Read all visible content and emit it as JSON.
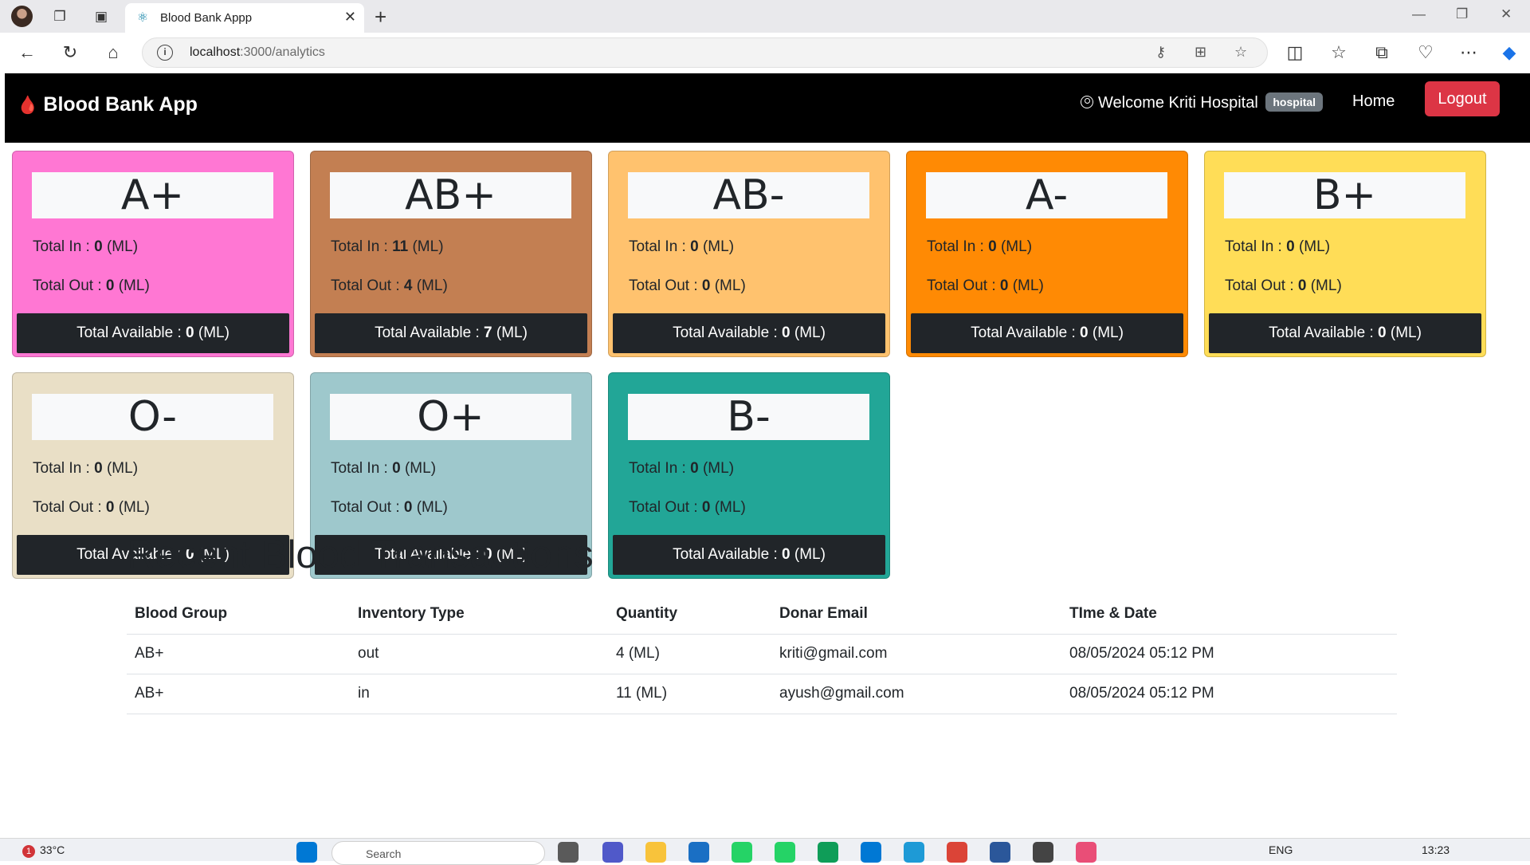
{
  "browser": {
    "tab_title": "Blood Bank Appp",
    "url_host": "localhost",
    "url_path": ":3000/analytics",
    "new_tab_glyph": "+",
    "close_glyph": "✕"
  },
  "navbar": {
    "brand": "Blood Bank App",
    "welcome": "Welcome Kriti Hospital",
    "role_badge": "hospital",
    "home_link": "Home",
    "logout_label": "Logout"
  },
  "labels": {
    "total_in": "Total In : ",
    "total_out": "Total Out : ",
    "total_available": "Total Available : ",
    "unit": " (ML)"
  },
  "cards": [
    {
      "group": "A+",
      "total_in": "0",
      "total_out": "0",
      "available": "0",
      "color": "#ff77d3"
    },
    {
      "group": "AB+",
      "total_in": "11",
      "total_out": "4",
      "available": "7",
      "color": "#c37f52"
    },
    {
      "group": "AB-",
      "total_in": "0",
      "total_out": "0",
      "available": "0",
      "color": "#ffc26e"
    },
    {
      "group": "A-",
      "total_in": "0",
      "total_out": "0",
      "available": "0",
      "color": "#ff8a04"
    },
    {
      "group": "B+",
      "total_in": "0",
      "total_out": "0",
      "available": "0",
      "color": "#ffdd57"
    },
    {
      "group": "O-",
      "total_in": "0",
      "total_out": "0",
      "available": "0",
      "color": "#e9dfc6"
    },
    {
      "group": "O+",
      "total_in": "0",
      "total_out": "0",
      "available": "0",
      "color": "#9ec8cc"
    },
    {
      "group": "B-",
      "total_in": "0",
      "total_out": "0",
      "available": "0",
      "color": "#22a697"
    }
  ],
  "transactions": {
    "title": "Recent Blood Transactions",
    "headers": [
      "Blood Group",
      "Inventory Type",
      "Quantity",
      "Donar Email",
      "TIme & Date"
    ],
    "rows": [
      [
        "AB+",
        "out",
        "4 (ML)",
        "kriti@gmail.com",
        "08/05/2024 05:12 PM"
      ],
      [
        "AB+",
        "in",
        "11 (ML)",
        "ayush@gmail.com",
        "08/05/2024 05:12 PM"
      ]
    ]
  },
  "taskbar": {
    "weather_alert": "1",
    "temperature": "33°C",
    "search_placeholder": "Search",
    "language": "ENG",
    "time": "13:23"
  }
}
